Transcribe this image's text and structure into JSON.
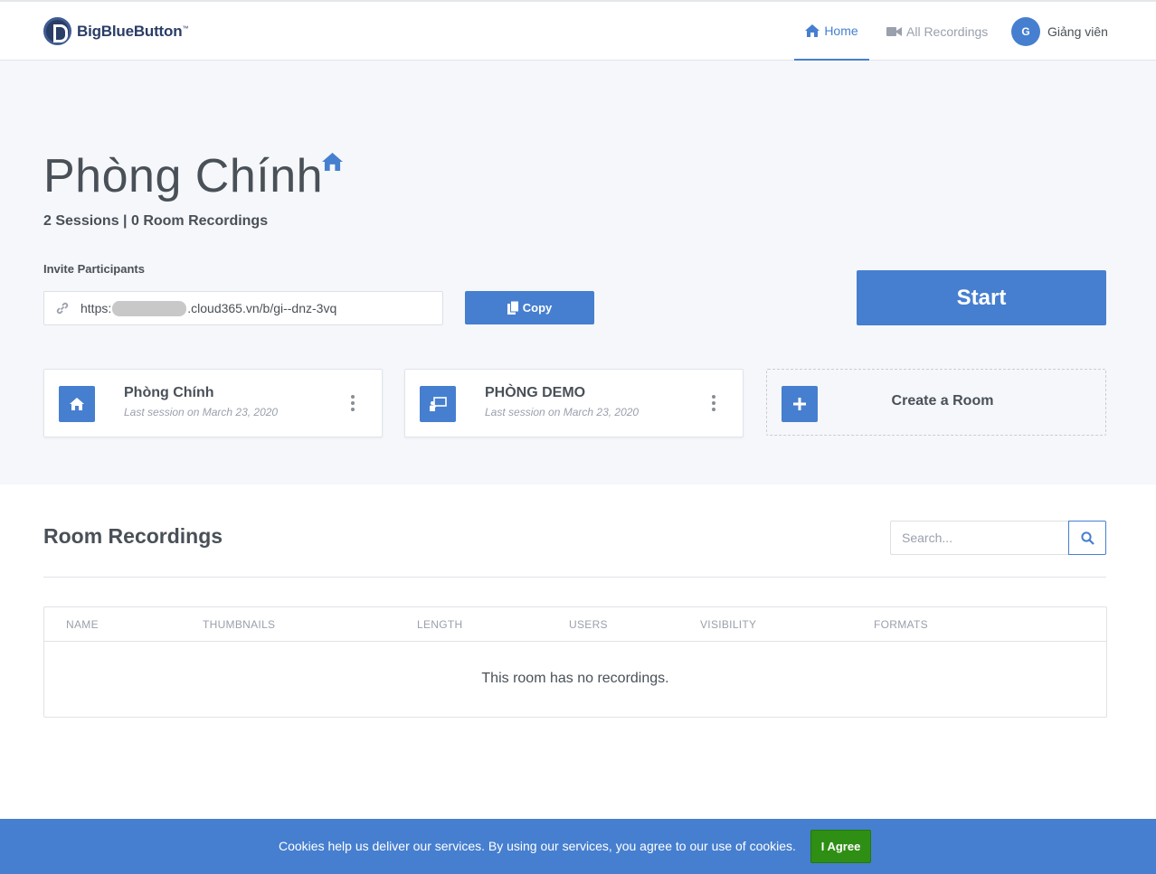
{
  "header": {
    "brand": "BigBlueButton",
    "brand_mark": "™",
    "nav_home": "Home",
    "nav_recordings": "All Recordings",
    "user_initial": "G",
    "user_name": "Giảng viên"
  },
  "room": {
    "title": "Phòng Chính",
    "stats": "2 Sessions | 0 Room Recordings",
    "invite_label": "Invite Participants",
    "invite_url_prefix": "https:",
    "invite_url_suffix": ".cloud365.vn/b/gi--dnz-3vq",
    "copy_label": "Copy",
    "start_label": "Start"
  },
  "cards": [
    {
      "name": "Phòng Chính",
      "session": "Last session on March 23, 2020",
      "icon": "home-icon"
    },
    {
      "name": "PHÒNG DEMO",
      "session": "Last session on March 23, 2020",
      "icon": "presentation-icon"
    }
  ],
  "create_room": {
    "label": "Create a Room",
    "icon": "plus-icon"
  },
  "recordings": {
    "title": "Room Recordings",
    "search_placeholder": "Search...",
    "columns": [
      "NAME",
      "THUMBNAILS",
      "LENGTH",
      "USERS",
      "VISIBILITY",
      "FORMATS"
    ],
    "empty_message": "This room has no recordings."
  },
  "cookie": {
    "message": "Cookies help us deliver our services. By using our services, you agree to our use of cookies.",
    "agree_label": "I Agree"
  },
  "colors": {
    "accent": "#467fcf",
    "brand": "#2a3d66",
    "agree": "#2f8f14",
    "background": "#f5f7fb"
  }
}
